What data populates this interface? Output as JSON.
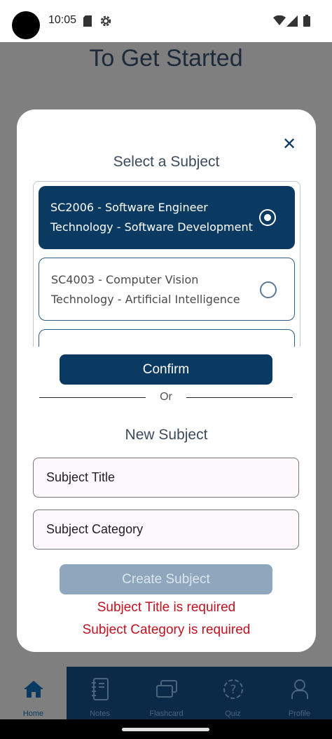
{
  "status_bar": {
    "time": "10:05"
  },
  "background_title": "To Get Started",
  "modal": {
    "select_heading": "Select a Subject",
    "subjects": [
      {
        "line1": "SC2006 - Software Engineer",
        "line2": "Technology - Software Development",
        "selected": true
      },
      {
        "line1": "SC4003 - Computer Vision",
        "line2": "Technology - Artificial Intelligence",
        "selected": false
      }
    ],
    "confirm_label": "Confirm",
    "or_label": "Or",
    "new_heading": "New Subject",
    "title_placeholder": "Subject Title",
    "category_placeholder": "Subject Category",
    "create_label": "Create Subject",
    "errors": [
      "Subject Title is required",
      "Subject Category is required"
    ]
  },
  "nav": {
    "items": [
      {
        "label": "Home",
        "icon": "home-icon",
        "active": true
      },
      {
        "label": "Notes",
        "icon": "notebook-icon",
        "active": false
      },
      {
        "label": "Flashcard",
        "icon": "flashcard-icon",
        "active": false
      },
      {
        "label": "Quiz",
        "icon": "quiz-icon",
        "active": false
      },
      {
        "label": "Profile",
        "icon": "profile-icon",
        "active": false
      }
    ]
  },
  "colors": {
    "primary": "#0a3a62",
    "nav_bg": "#0a2a47",
    "error": "#c1121f",
    "disabled": "#8ea7bd"
  }
}
